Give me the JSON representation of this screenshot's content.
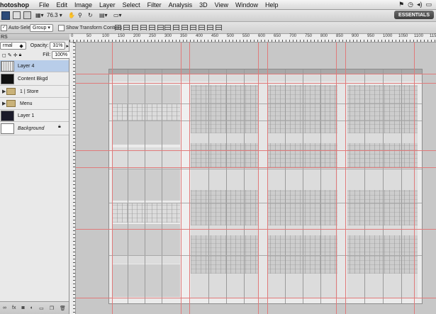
{
  "menubar": {
    "app_name": "hotoshop",
    "items": [
      "File",
      "Edit",
      "Image",
      "Layer",
      "Select",
      "Filter",
      "Analysis",
      "3D",
      "View",
      "Window",
      "Help"
    ]
  },
  "appbar": {
    "zoom": "76.3",
    "workspace_button": "ESSENTIALS"
  },
  "options": {
    "auto_select_label": "Auto-Select:",
    "auto_select_value": "Group",
    "show_transform_label": "Show Transform Controls"
  },
  "layers_panel": {
    "tab_label": "RS",
    "blend_mode": "rmal",
    "opacity_label": "Opacity:",
    "opacity_value": "31%",
    "fill_label": "Fill:",
    "fill_value": "100%",
    "layers": [
      {
        "name": "Layer 4",
        "type": "layer",
        "selected": true
      },
      {
        "name": "Content Bkgd",
        "type": "layer",
        "selected": false
      },
      {
        "name": "1 | Store",
        "type": "group",
        "selected": false
      },
      {
        "name": "Menu",
        "type": "group",
        "selected": false
      },
      {
        "name": "Layer 1",
        "type": "layer",
        "selected": false
      },
      {
        "name": "Background",
        "type": "layer",
        "selected": false,
        "locked": true
      }
    ]
  },
  "ruler_labels": [
    "0",
    "50",
    "100",
    "150",
    "200",
    "250",
    "300",
    "350",
    "400",
    "450",
    "500",
    "550",
    "600",
    "650",
    "700",
    "750",
    "800",
    "850",
    "900",
    "950",
    "1000",
    "1050",
    "1100",
    "1150"
  ],
  "colors": {
    "guide": "#e07a7a",
    "selection": "#b8cde9"
  }
}
